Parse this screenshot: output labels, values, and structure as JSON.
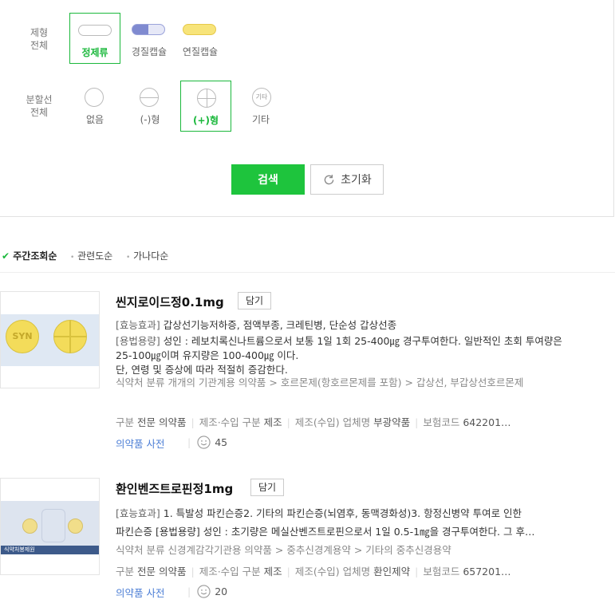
{
  "filters": {
    "form": {
      "label_line1": "제형",
      "label_line2": "전체",
      "options": [
        {
          "label": "정제류",
          "selected": true,
          "color": "#ffffff"
        },
        {
          "label": "경질캡슐",
          "selected": false,
          "color": "#8a94d6"
        },
        {
          "label": "연질캡슐",
          "selected": false,
          "color": "#f5e06a"
        }
      ]
    },
    "score": {
      "label_line1": "분할선",
      "label_line2": "전체",
      "options": [
        {
          "label": "없음",
          "selected": false,
          "icon": "circle-plain-icon"
        },
        {
          "label": "(-)형",
          "selected": false,
          "icon": "circle-minus-icon"
        },
        {
          "label": "(+)형",
          "selected": true,
          "icon": "circle-plus-icon"
        },
        {
          "label": "기타",
          "selected": false,
          "icon": "circle-other-icon",
          "icon_text": "기타"
        }
      ]
    },
    "search_label": "검색",
    "reset_label": "초기화"
  },
  "sort": {
    "items": [
      {
        "label": "주간조회순",
        "active": true
      },
      {
        "label": "관련도순",
        "active": false
      },
      {
        "label": "가나다순",
        "active": false
      }
    ]
  },
  "results": [
    {
      "name": "씬지로이드정0.1mg",
      "save_label": "담기",
      "thumb_text": "SYN",
      "desc_line1_key": "[효능효과]",
      "desc_line1": "갑상선기능저하증, 점액부종, 크레틴병, 단순성 갑상선종",
      "desc_line2_key": "[용법용량]",
      "desc_line2": "성인 : 레보치록신나트륨으로서 보통 1일 1회 25-400㎍ 경구투여한다. 일반적인 초회 투여량은 25-100㎍이며 유지량은 100-400㎍ 이다.",
      "desc_line3": "단, 연령 및 증상에 따라 적절히 증감한다.",
      "category": "식약처 분류  개개의 기관계용 의약품 > 호르몬제(항호르몬제를 포함) > 갑상선, 부갑상선호르몬제",
      "meta": [
        {
          "k": "구분",
          "v": "전문 의약품"
        },
        {
          "k": "제조·수입 구분",
          "v": "제조"
        },
        {
          "k": "제조(수입) 업체명",
          "v": "부광약품"
        },
        {
          "k": "보험코드",
          "v": "642201…"
        }
      ],
      "dict_label": "의약품 사전",
      "likes": "45"
    },
    {
      "name": "환인벤즈트로핀정1mg",
      "save_label": "담기",
      "thumb_text": "식약처봉제원",
      "desc_line1_key": "[효능효과]",
      "desc_line1": "1. 특발성 파킨슨증2. 기타의 파킨슨증(뇌염후, 동맥경화성)3. 항정신병약 투여로 인한",
      "desc_line2": "파킨슨증 [용법용량] 성인 : 초기량은 메실산벤즈트로핀으로서 1일 0.5-1㎎을 경구투여한다. 그 후…",
      "category": "식약처 분류  신경계감각기관용 의약품 > 중추신경계용약 > 기타의 중추신경용약",
      "meta": [
        {
          "k": "구분",
          "v": "전문 의약품"
        },
        {
          "k": "제조·수입 구분",
          "v": "제조"
        },
        {
          "k": "제조(수입) 업체명",
          "v": "환인제약"
        },
        {
          "k": "보험코드",
          "v": "657201…"
        }
      ],
      "dict_label": "의약품 사전",
      "likes": "20"
    }
  ]
}
